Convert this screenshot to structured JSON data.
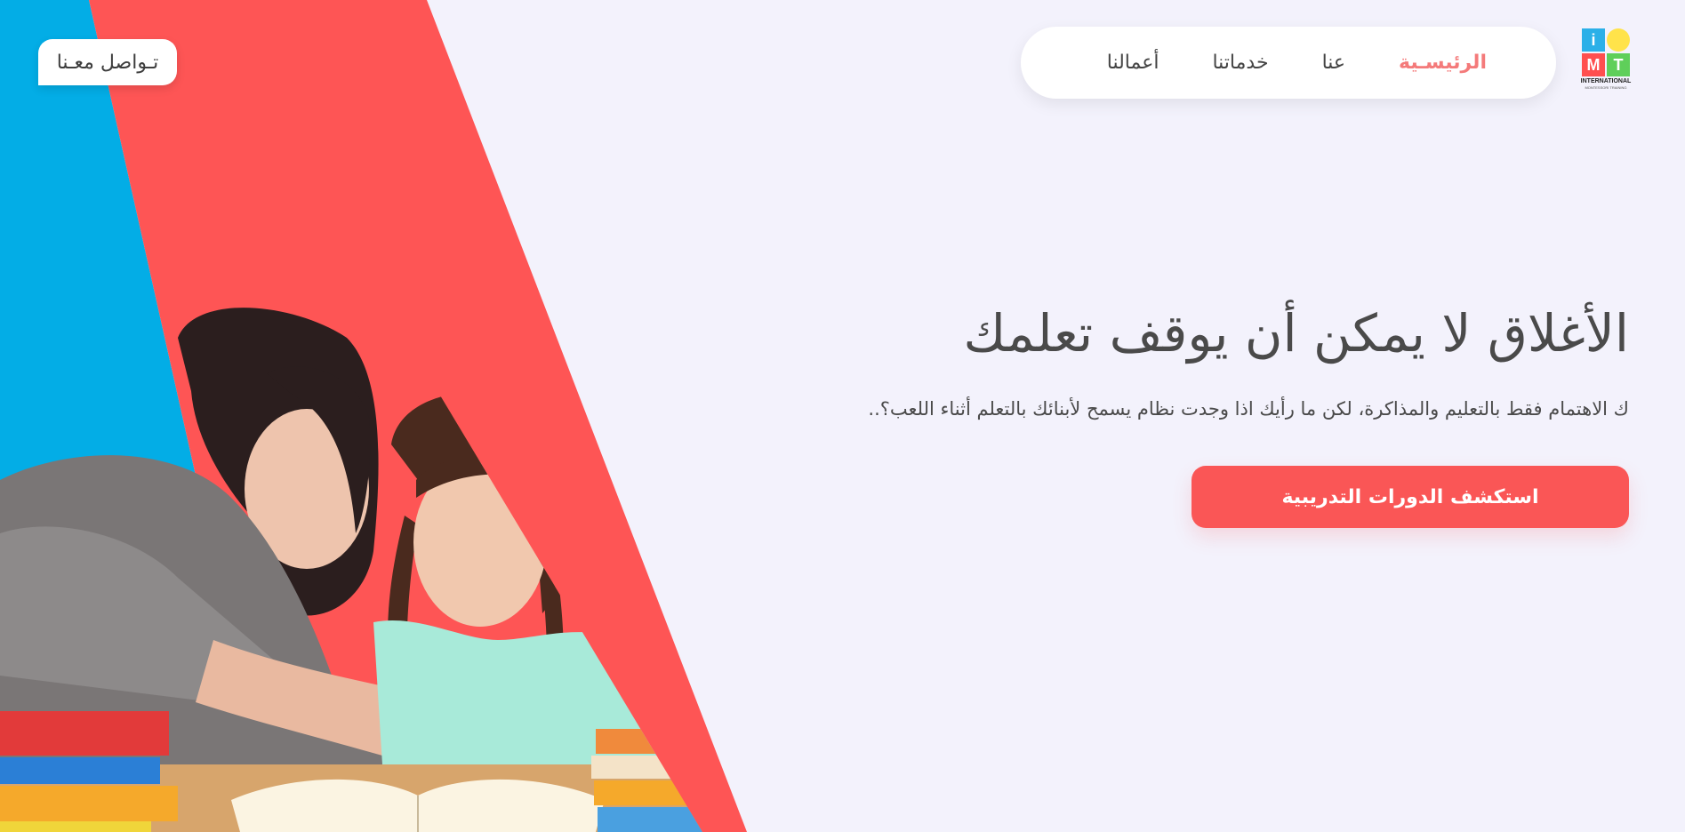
{
  "header": {
    "contact_label": "تـواصل معـنا",
    "nav": [
      {
        "label": "الرئيسـية",
        "active": true
      },
      {
        "label": "عنا",
        "active": false
      },
      {
        "label": "خدماتنا",
        "active": false
      },
      {
        "label": "أعمالنا",
        "active": false
      }
    ],
    "logo": {
      "letters": [
        "i",
        "M",
        "T"
      ],
      "name": "INTERNATIONAL",
      "tagline": "MONTESSORI TRAINING",
      "colors": {
        "i": "#2bb0e8",
        "dot": "#ffe34a",
        "M": "#ff4f4f",
        "T": "#5fcf5a"
      }
    }
  },
  "hero": {
    "title": "الأغلاق لا يمكن أن يوقف تعلمك",
    "description": "ك الاهتمام فقط بالتعليم والمذاكرة، لكن ما رأيك اذا وجدت نظام يسمح لأبنائك بالتعلم أثناء اللعب؟..",
    "cta_label": "استكشف الدورات التدريبية"
  },
  "colors": {
    "background": "#f3f2fc",
    "blue_band": "#03ade6",
    "red_band": "#fe5555",
    "accent": "#fa5656",
    "nav_active": "#f47a7a"
  }
}
